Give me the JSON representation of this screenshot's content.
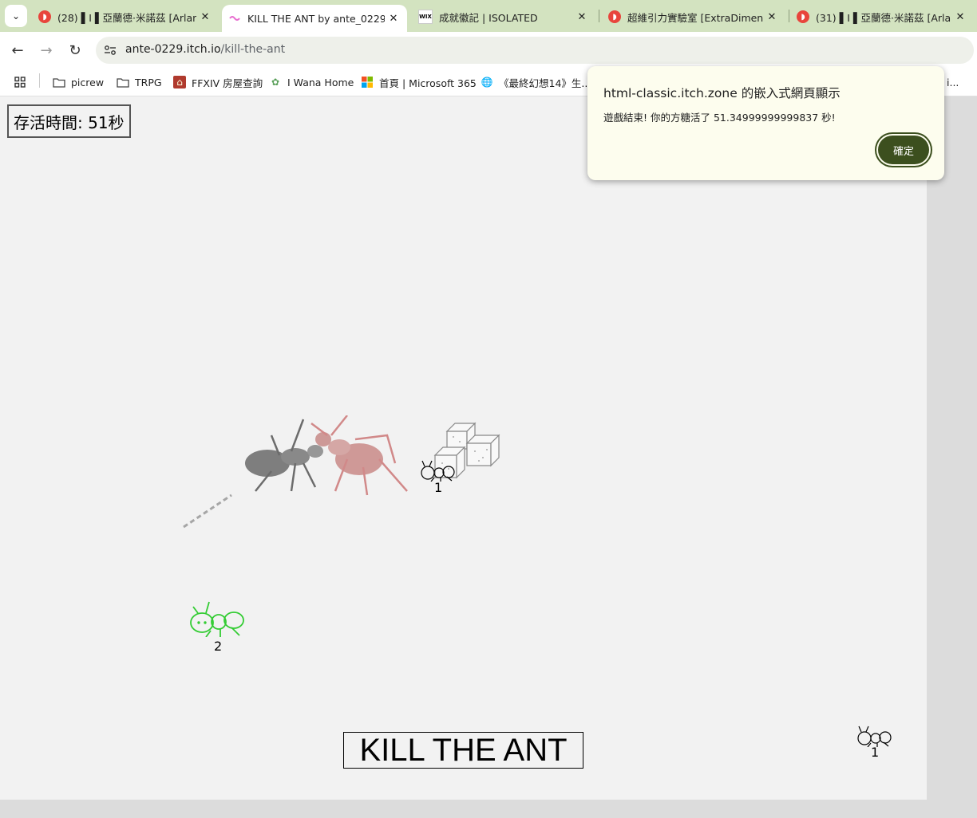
{
  "tabs": [
    {
      "title": "(28) ▌I ▌亞蘭德·米諾茲 [Arland",
      "close": "✕"
    },
    {
      "title": "KILL THE ANT by ante_0229",
      "close": "✕"
    },
    {
      "title": "成就徽記 | ISOLATED",
      "close": "✕",
      "favicon_text": "WIX"
    },
    {
      "title": "超維引力實驗室 [ExtraDimensi",
      "close": "✕"
    },
    {
      "title": "(31) ▌I ▌亞蘭德·米諾茲 [Arland",
      "close": "✕"
    }
  ],
  "address": {
    "host": "ante-0229.itch.io",
    "path": "/kill-the-ant"
  },
  "bookmarks": [
    {
      "label": "picrew"
    },
    {
      "label": "TRPG"
    },
    {
      "label": "FFXIV 房屋查詢"
    },
    {
      "label": "I Wana Home"
    },
    {
      "label": "首頁 | Microsoft 365"
    },
    {
      "label": "《最終幻想14》生..."
    },
    {
      "label": "i..."
    }
  ],
  "game": {
    "timer": "存活時間: 51秒",
    "title": "KILL THE ANT",
    "ant_labels": [
      "1",
      "2",
      "1"
    ]
  },
  "dialog": {
    "title": "html-classic.itch.zone 的嵌入式網頁顯示",
    "message": "遊戲結束! 你的方糖活了 51.34999999999837 秒!",
    "ok": "確定"
  },
  "colors": {
    "tab_strip": "#d3e3c0",
    "dialog_button": "#3c4f1e",
    "game_bg": "#f2f2f2",
    "green_ant": "#33cc33"
  }
}
